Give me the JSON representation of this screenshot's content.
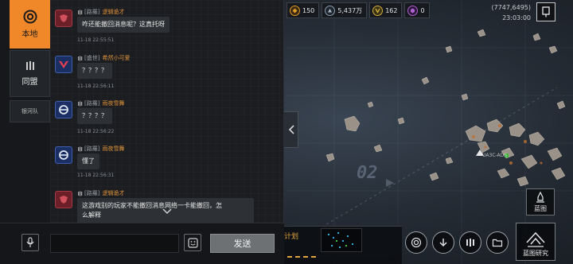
{
  "tabs": [
    {
      "label": "本地",
      "icon": "target-icon"
    },
    {
      "label": "同盟",
      "icon": "alliance-icon"
    },
    {
      "label": "银河队",
      "icon": ""
    }
  ],
  "messages": [
    {
      "tag": "[路羅]",
      "name": "逻辑诡才",
      "text": "咋还能撤回消息呢？这真托呀",
      "time": "11-18 22:55:51",
      "avatar": "red"
    },
    {
      "tag": "[盛世]",
      "name": "希然小可爱",
      "text": "？？？？",
      "time": "11-18 22:56:11",
      "avatar": "blue-v"
    },
    {
      "tag": "[路羅]",
      "name": "雨夜雪舞",
      "text": "？？？？",
      "time": "11-18 22:56:22",
      "avatar": "blue-ring"
    },
    {
      "tag": "[路羅]",
      "name": "雨夜雪舞",
      "text": "懂了",
      "time": "11-18 22:56:31",
      "avatar": "blue-ring"
    },
    {
      "tag": "[路羅]",
      "name": "逻辑诡才",
      "text_line1": "这游戏别的玩家不能撤回消息网络一卡能撤回，怎",
      "text_line2": "么解释",
      "avatar": "red"
    }
  ],
  "input": {
    "placeholder": "",
    "value": ""
  },
  "send_label": "发送",
  "resources": [
    {
      "value": "150",
      "icon": "fuel-icon",
      "color": "#e09a2a"
    },
    {
      "value": "5,437万",
      "icon": "metal-icon",
      "color": "#8a9bb0"
    },
    {
      "value": "162",
      "icon": "crystal-icon",
      "color": "#d4b040"
    },
    {
      "value": "0",
      "icon": "gas-icon",
      "color": "#b060d0"
    }
  ],
  "coords": "(7747,6495)",
  "clock": "23:03:00",
  "sector": "02",
  "unit_label": "UA3C-ADS",
  "blueprint_label": "蓝图",
  "plan_label": "计划",
  "blueprint_research_label": "蓝图研究",
  "colors": {
    "accent": "#f0882a",
    "username": "#e0923a",
    "panel": "#1a1c1f"
  }
}
